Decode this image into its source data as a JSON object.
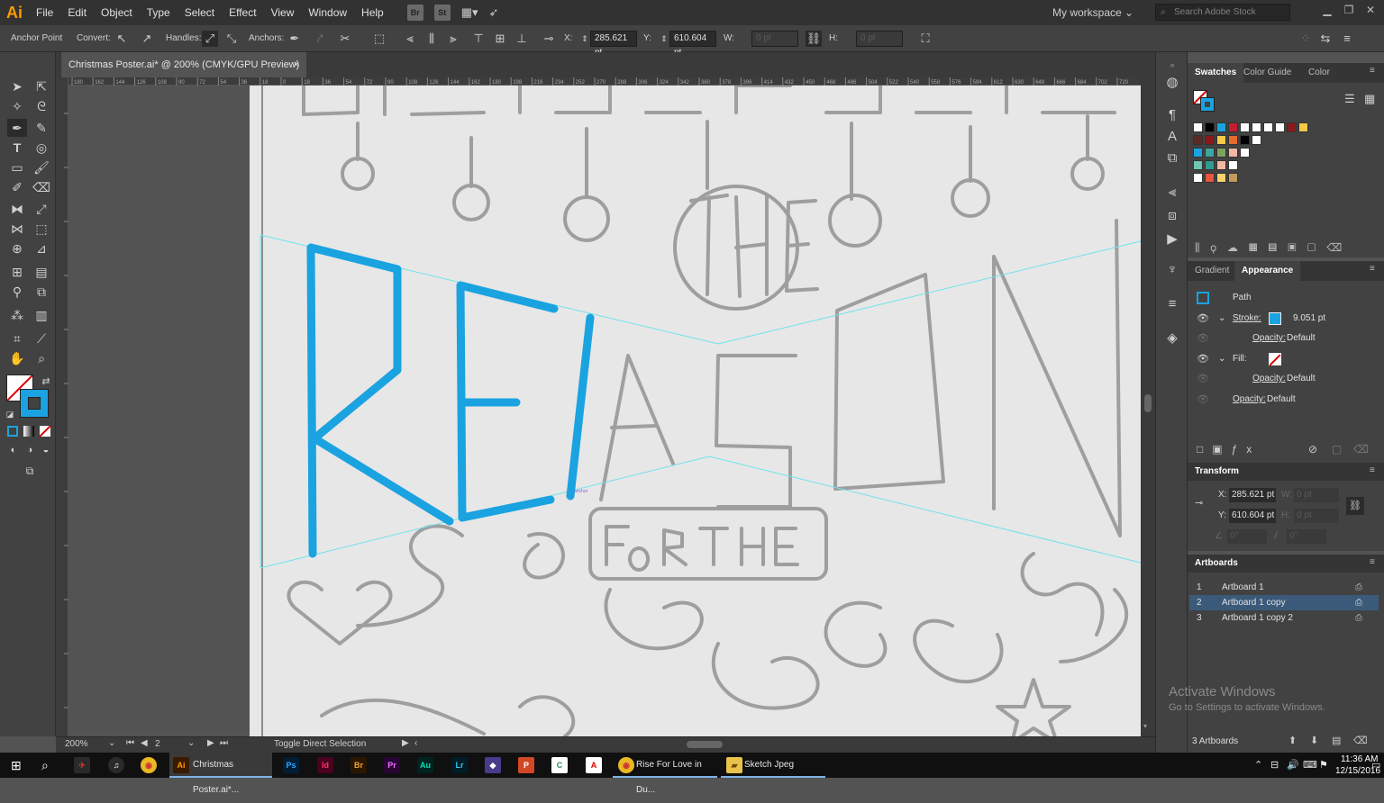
{
  "app": {
    "logo": "Ai"
  },
  "menu": [
    "File",
    "Edit",
    "Object",
    "Type",
    "Select",
    "Effect",
    "View",
    "Window",
    "Help"
  ],
  "menubar_tools": {
    "bridge": "Br",
    "stock": "St"
  },
  "workspace": "My workspace",
  "search_placeholder": "Search Adobe Stock",
  "control": {
    "anchor_point": "Anchor Point",
    "convert": "Convert:",
    "handles": "Handles:",
    "anchors": "Anchors:",
    "x_label": "X:",
    "x_value": "285.621 pt",
    "y_label": "Y:",
    "y_value": "610.604 pt",
    "w_label": "W:",
    "w_value": "0 pt",
    "h_label": "H:",
    "h_value": "0 pt"
  },
  "document_tab": {
    "title": "Christmas Poster.ai* @ 200% (CMYK/GPU Preview)",
    "close": "×"
  },
  "ruler_ticks": [
    "180",
    "162",
    "144",
    "126",
    "108",
    "90",
    "72",
    "54",
    "36",
    "18",
    "0",
    "18",
    "36",
    "54",
    "72",
    "90",
    "108",
    "126",
    "144",
    "162",
    "180",
    "198",
    "216",
    "234",
    "252",
    "270",
    "288",
    "306",
    "324",
    "342",
    "360",
    "378",
    "396",
    "414",
    "432",
    "450",
    "468",
    "486",
    "504",
    "522",
    "540",
    "558",
    "576",
    "594",
    "612",
    "630",
    "648",
    "666",
    "684",
    "702",
    "720"
  ],
  "status": {
    "zoom": "200%",
    "artboard_num": "2",
    "message": "Toggle Direct Selection"
  },
  "swatches_panel": {
    "tabs": [
      "Swatches",
      "Color Guide",
      "Color"
    ]
  },
  "appearance_panel": {
    "tabs": [
      "Gradient",
      "Appearance"
    ],
    "object": "Path",
    "stroke_label": "Stroke:",
    "stroke_value": "9.051 pt",
    "opacity_label": "Opacity:",
    "opacity_value": "Default",
    "fill_label": "Fill:",
    "opacity2_label": "Opacity:",
    "opacity2_value": "Default",
    "opacity3_label": "Opacity:",
    "opacity3_value": "Default"
  },
  "transform_panel": {
    "title": "Transform",
    "x_label": "X:",
    "x_value": "285.621 pt",
    "y_label": "Y:",
    "y_value": "610.604 pt",
    "w_label": "W:",
    "w_value": "0 pt",
    "h_label": "H:",
    "h_value": "0 pt",
    "rot_value": "0°",
    "shear_value": "0°"
  },
  "artboards_panel": {
    "title": "Artboards",
    "items": [
      {
        "num": "1",
        "name": "Artboard 1"
      },
      {
        "num": "2",
        "name": "Artboard 1 copy"
      },
      {
        "num": "3",
        "name": "Artboard 1 copy 2"
      }
    ],
    "count": "3 Artboards"
  },
  "colors": {
    "accent_blue": "#1aa3e0",
    "swatches": [
      "#ffffff",
      "#000000",
      "#1aa3e0",
      "#c0212f",
      "#f5c84a",
      "#e86a2c",
      "#3aa7a0",
      "#7ea35f",
      "#f3b7a4",
      "#e7e1c2",
      "#5b2a24",
      "#8a1a1a",
      "#6fc6b0",
      "#2e9d8f",
      "#e8543e",
      "#f6d36a",
      "#c49a5a"
    ]
  },
  "taskbar": {
    "illustrator_window": "Christmas Poster.ai*...",
    "chrome_window": "Rise For Love in Du...",
    "sketch_window": "Sketch Jpeg",
    "apps": [
      "Ps",
      "Id",
      "Br",
      "Pr",
      "Au",
      "Lr"
    ],
    "time": "11:36 AM",
    "date": "12/15/2016"
  },
  "watermark": {
    "title": "Activate Windows",
    "subtitle": "Go to Settings to activate Windows."
  }
}
